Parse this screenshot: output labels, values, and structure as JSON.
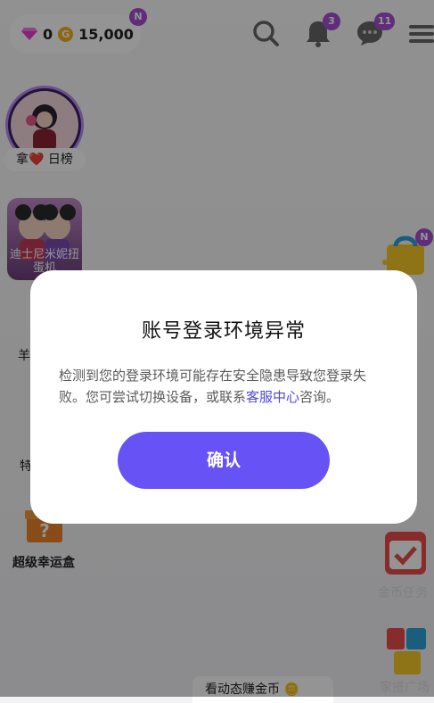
{
  "topbar": {
    "gems": "0",
    "coin_symbol": "G",
    "coins": "15,000",
    "currency_badge": "N",
    "notification_count": "3",
    "message_count": "11"
  },
  "left": {
    "ranking_label": "拿❤️ 日榜",
    "gacha_label": "迪士尼米妮扭蛋机",
    "label_sheep": "羊",
    "label_special": "特",
    "lucky_box_label": "超级幸运盒"
  },
  "right": {
    "shop_badge": "N",
    "task_label": "金币任务",
    "square_label": "家搭广场"
  },
  "bottom": {
    "strip_text": "看动态赚金币 🪙"
  },
  "dialog": {
    "title": "账号登录环境异常",
    "message_prefix": "检测到您的登录环境可能存在安全隐患导致您登录失败。您可尝试切换设备，或联系",
    "link_text": "客服中心",
    "message_suffix": "咨询。",
    "confirm_label": "确认"
  },
  "colors": {
    "accent": "#6752f5",
    "badge": "#a54fd4",
    "link": "#4e46e0"
  }
}
